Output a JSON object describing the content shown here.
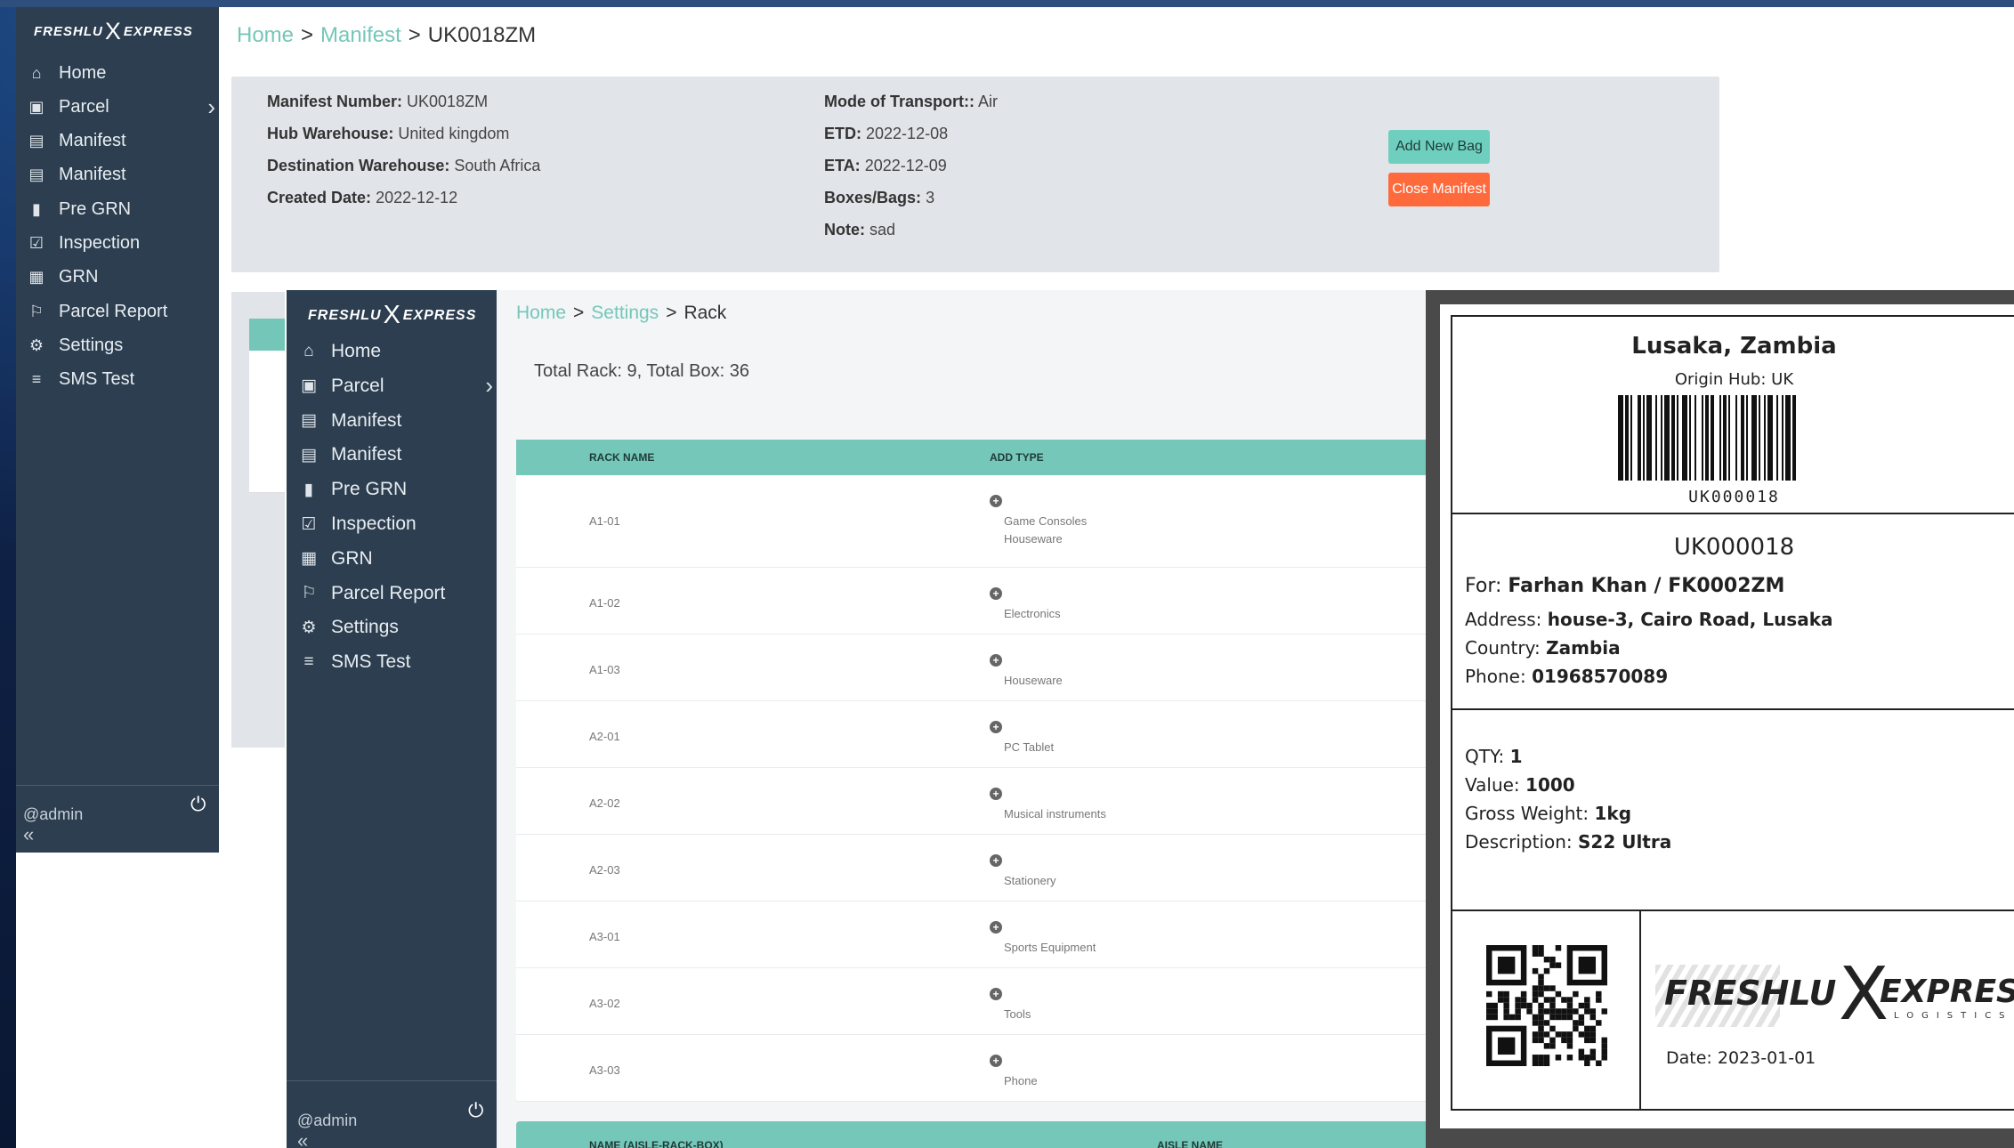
{
  "brand": {
    "logo_left": "FRESHLU",
    "logo_x": "X",
    "logo_right": "EXPRESS",
    "logo_sub": "LOGISTICS"
  },
  "sidebar": {
    "items": [
      {
        "label": "Home",
        "icon": "home-icon"
      },
      {
        "label": "Parcel",
        "icon": "briefcase-icon",
        "has_submenu": true
      },
      {
        "label": "Manifest",
        "icon": "archive-icon"
      },
      {
        "label": "Manifest",
        "icon": "archive-icon"
      },
      {
        "label": "Pre GRN",
        "icon": "clipboard-icon"
      },
      {
        "label": "Inspection",
        "icon": "clipboard-check-icon"
      },
      {
        "label": "GRN",
        "icon": "boxes-icon"
      },
      {
        "label": "Parcel Report",
        "icon": "flag-icon"
      },
      {
        "label": "Settings",
        "icon": "gear-icon"
      },
      {
        "label": "SMS Test",
        "icon": "list-icon"
      }
    ],
    "user": "@admin",
    "collapse_glyph": "«"
  },
  "manifest_page": {
    "breadcrumb": {
      "home": "Home",
      "section": "Manifest",
      "current": "UK0018ZM",
      "sep": ">"
    },
    "left_fields": [
      {
        "label": "Manifest Number:",
        "value": "UK0018ZM"
      },
      {
        "label": "Hub Warehouse:",
        "value": "United kingdom"
      },
      {
        "label": "Destination Warehouse:",
        "value": "South Africa"
      },
      {
        "label": "Created Date:",
        "value": "2022-12-12"
      }
    ],
    "right_fields": [
      {
        "label": "Mode of Transport::",
        "value": "Air"
      },
      {
        "label": "ETD:",
        "value": "2022-12-08"
      },
      {
        "label": "ETA:",
        "value": "2022-12-09"
      },
      {
        "label": "Boxes/Bags:",
        "value": "3"
      },
      {
        "label": "Note:",
        "value": "sad"
      }
    ],
    "buttons": {
      "add_bag": "Add New Bag",
      "close_manifest": "Close Manifest"
    }
  },
  "rack_page": {
    "breadcrumb": {
      "home": "Home",
      "section": "Settings",
      "current": "Rack",
      "sep": ">"
    },
    "total": "Total Rack: 9, Total Box: 36",
    "columns": {
      "rack_name": "RACK NAME",
      "add_type": "ADD TYPE"
    },
    "rows": [
      {
        "name": "A1-01",
        "types": [
          "Game Consoles",
          "Houseware"
        ]
      },
      {
        "name": "A1-02",
        "types": [
          "Electronics"
        ]
      },
      {
        "name": "A1-03",
        "types": [
          "Houseware"
        ]
      },
      {
        "name": "A2-01",
        "types": [
          "PC Tablet"
        ]
      },
      {
        "name": "A2-02",
        "types": [
          "Musical instruments"
        ]
      },
      {
        "name": "A2-03",
        "types": [
          "Stationery"
        ]
      },
      {
        "name": "A3-01",
        "types": [
          "Sports Equipment"
        ]
      },
      {
        "name": "A3-02",
        "types": [
          "Tools"
        ]
      },
      {
        "name": "A3-03",
        "types": [
          "Phone"
        ]
      }
    ],
    "aisle_columns": {
      "name": "NAME (AISLE-RACK-BOX)",
      "aisle_name": "AISLE NAME"
    }
  },
  "label": {
    "city": "Lusaka, Zambia",
    "origin": "Origin Hub: UK",
    "barcode_text": "UK000018",
    "code": "UK000018",
    "for_label": "For:",
    "for_value": "Farhan Khan / FK0002ZM",
    "address_label": "Address:",
    "address_value": "house-3, Cairo Road, Lusaka",
    "country_label": "Country:",
    "country_value": "Zambia",
    "phone_label": "Phone:",
    "phone_value": "01968570089",
    "qty_label": "QTY:",
    "qty_value": "1",
    "value_label": "Value:",
    "value_value": "1000",
    "gw_label": "Gross Weight:",
    "gw_value": "1kg",
    "desc_label": "Description:",
    "desc_value": "S22 Ultra",
    "date": "Date: 2023-01-01"
  },
  "colors": {
    "sidebar": "#2c3e50",
    "accent": "#74c7b9",
    "danger": "#ff6a3d",
    "card": "#e1e5e9"
  }
}
